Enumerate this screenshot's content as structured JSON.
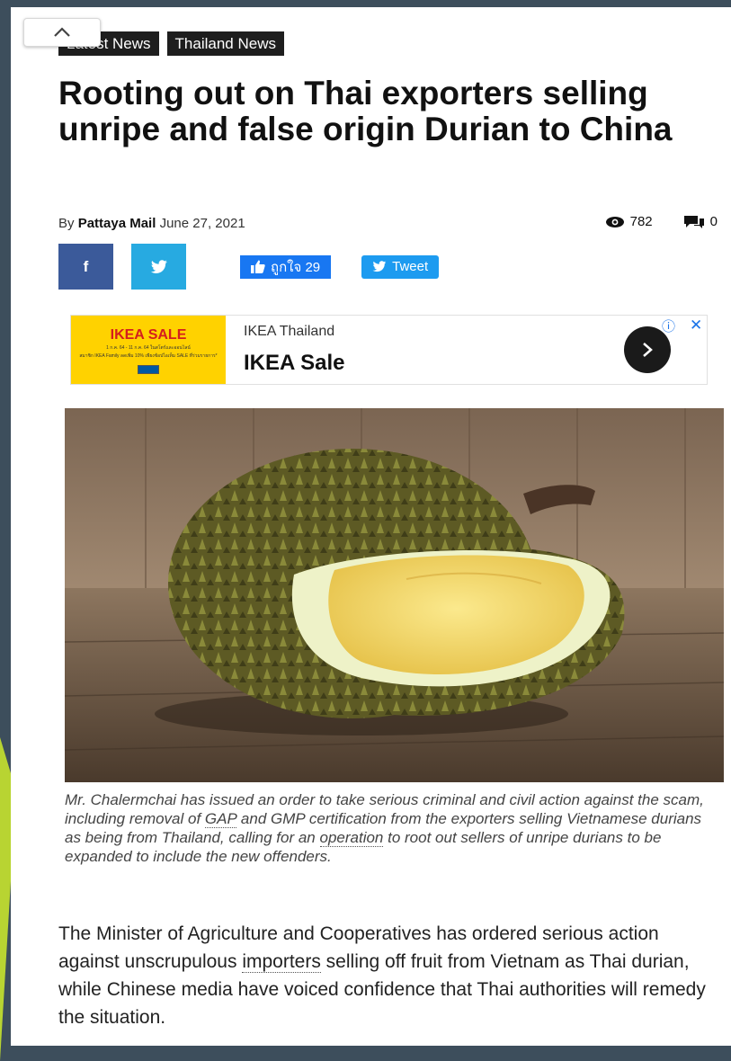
{
  "nav": {
    "collapse_icon": "chevron-up-icon"
  },
  "categories": [
    "Latest News",
    "Thailand News"
  ],
  "article": {
    "title": "Rooting out on Thai exporters selling unripe and false origin Durian to China",
    "by_prefix": "By",
    "author": "Pattaya Mail",
    "date": "June 27, 2021",
    "views": "782",
    "comments": "0"
  },
  "share": {
    "facebook_label": "f",
    "like_label": "ถูกใจ 29",
    "tweet_label": "Tweet"
  },
  "ad": {
    "image_title": "IKEA SALE",
    "image_line1": "1 ก.ค. 64 - 11 ก.ค. 64 ในสโตร์และออนไลน์",
    "image_line2": "สมาชิก IKEA Family ลดเพิ่ม 10% เพียงช้อปไอเท็ม SALE ที่ร่วมรายการ*",
    "advertiser": "IKEA Thailand",
    "headline": "IKEA Sale",
    "info_icon": "ⓘ",
    "close_icon": "✕"
  },
  "caption": {
    "part1": "Mr. Chalermchai has issued an order to take serious criminal and civil action against the scam, including removal of ",
    "link1": "GAP",
    "part2": " and GMP certification from the exporters selling Vietnamese durians as being from Thailand, calling for an ",
    "link2": "operation",
    "part3": " to root out sellers of unripe durians to be expanded to include the new offenders."
  },
  "body": {
    "part1": "The Minister of Agriculture and Cooperatives has ordered serious action against unscrupulous ",
    "link1": "importers",
    "part2": " selling off fruit from Vietnam as Thai durian, while Chinese media have voiced confidence that Thai authorities will remedy the situation."
  },
  "colors": {
    "facebook": "#3b5a9a",
    "twitter": "#27aae1",
    "like": "#1877f2",
    "ad_yellow": "#ffd200",
    "ad_red": "#d41e1e",
    "backdrop": "#3d4e5c"
  }
}
